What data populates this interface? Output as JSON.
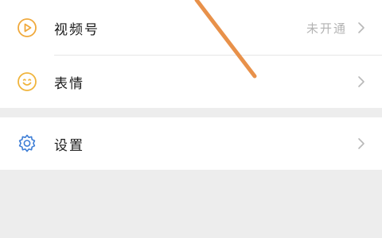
{
  "menu": {
    "channels": {
      "label": "视频号",
      "value": "未开通",
      "icon": "play-circle-icon",
      "icon_color": "#f0a93c"
    },
    "stickers": {
      "label": "表情",
      "icon": "smiley-face-icon",
      "icon_color": "#f0b43c"
    },
    "settings": {
      "label": "设置",
      "icon": "gear-icon",
      "icon_color": "#3e7ed6"
    }
  },
  "colors": {
    "background": "#ededed",
    "row_background": "#ffffff",
    "annotation_stroke": "#e8914a"
  }
}
